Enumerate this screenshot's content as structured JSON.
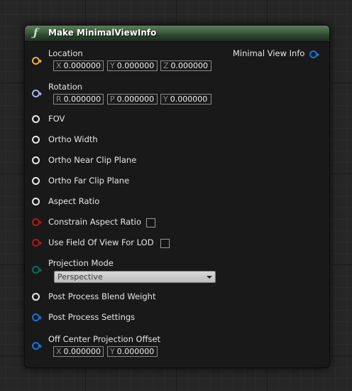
{
  "node": {
    "title": "Make MinimalViewInfo",
    "icon": "function-icon",
    "header_color": "#3d5a3c"
  },
  "output": {
    "label": "Minimal View Info",
    "pin_color": "#1a73d8"
  },
  "inputs": {
    "location": {
      "label": "Location",
      "x_axis": "X",
      "x_value": "0.000000",
      "y_axis": "Y",
      "y_value": "0.000000",
      "z_axis": "Z",
      "z_value": "0.000000",
      "pin_color": "#eab33a"
    },
    "rotation": {
      "label": "Rotation",
      "r_axis": "R",
      "r_value": "0.000000",
      "p_axis": "P",
      "p_value": "0.000000",
      "y_axis": "Y",
      "y_value": "0.000000",
      "pin_color": "#a7b3e8"
    },
    "fov": {
      "label": "FOV"
    },
    "ortho_width": {
      "label": "Ortho Width"
    },
    "ortho_near": {
      "label": "Ortho Near Clip Plane"
    },
    "ortho_far": {
      "label": "Ortho Far Clip Plane"
    },
    "aspect_ratio": {
      "label": "Aspect Ratio"
    },
    "constrain_aspect": {
      "label": "Constrain Aspect Ratio",
      "checked": false,
      "pin_color": "#b01717"
    },
    "use_fov_lod": {
      "label": "Use Field Of View For LOD",
      "checked": false,
      "pin_color": "#b01717"
    },
    "projection_mode": {
      "label": "Projection Mode",
      "selected": "Perspective",
      "pin_color": "#0b6c5a"
    },
    "post_process_weight": {
      "label": "Post Process Blend Weight"
    },
    "post_process_settings": {
      "label": "Post Process Settings",
      "pin_color": "#1a73d8"
    },
    "off_center": {
      "label": "Off Center Projection Offset",
      "x_axis": "X",
      "x_value": "0.000000",
      "y_axis": "Y",
      "y_value": "0.000000",
      "pin_color": "#1a73d8"
    }
  }
}
